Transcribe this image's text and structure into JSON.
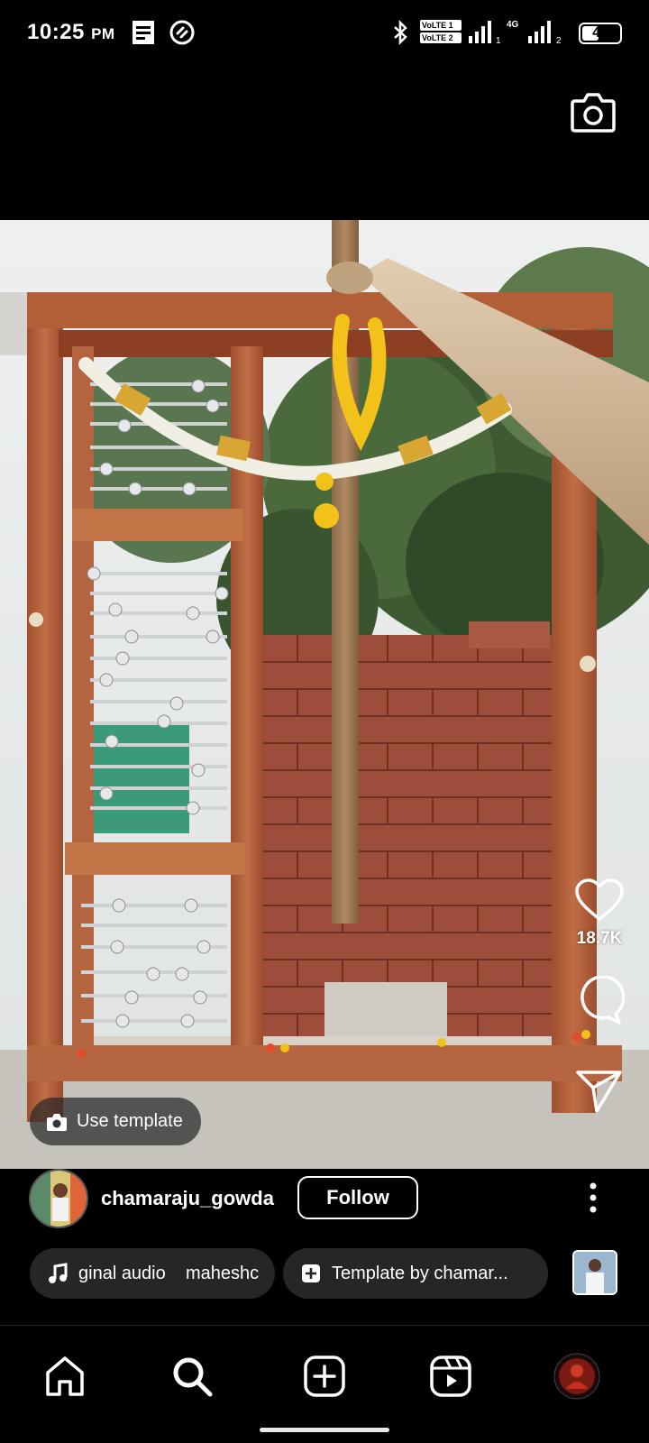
{
  "status_bar": {
    "time": "10:25",
    "ampm": "PM",
    "lte1": "VoLTE 1",
    "lte2": "VoLTE 2",
    "sim1": "1",
    "sim2": "2",
    "network": "4G",
    "battery": "46",
    "battery_level": 0.46
  },
  "camera_icon": "camera-icon",
  "video": {
    "likes": "18.7K",
    "use_template_label": "Use template"
  },
  "author": {
    "username": "chamaraju_gowda",
    "follow_label": "Follow"
  },
  "audio_chip": {
    "text": "ginal audio    maheshc"
  },
  "template_chip": {
    "text": "Template by chamar..."
  },
  "nav": [
    "home-icon",
    "search-icon",
    "create-icon",
    "reels-icon",
    "profile-icon"
  ],
  "colors": {
    "background": "#000000",
    "chip_bg": "#262626",
    "wood": "#b0623c",
    "brick": "#9e4d3b",
    "marigold": "#f2c21a"
  }
}
